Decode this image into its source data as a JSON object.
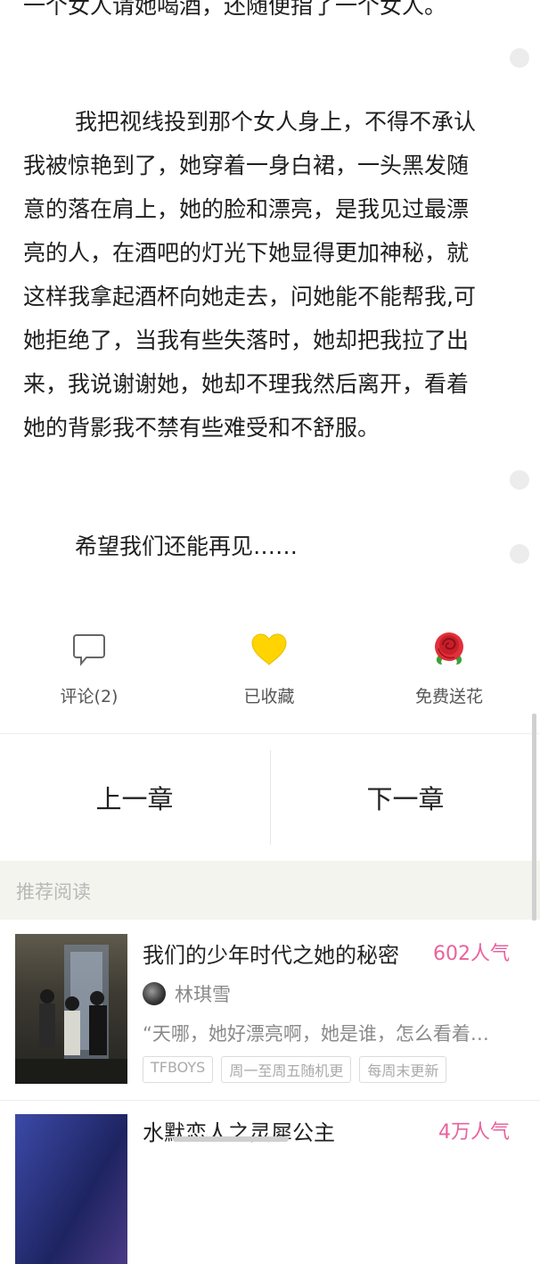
{
  "content": {
    "paragraphs": [
      "一个女人请她喝酒，还随便指了一个女人。",
      "我把视线投到那个女人身上，不得不承认我被惊艳到了，她穿着一身白裙，一头黑发随意的落在肩上，她的脸和漂亮，是我见过最漂亮的人，在酒吧的灯光下她显得更加神秘，就这样我拿起酒杯向她走去，问她能不能帮我,可她拒绝了，当我有些失落时，她却把我拉了出来，我说谢谢她，她却不理我然后离开，看着她的背影我不禁有些难受和不舒服。",
      "希望我们还能再见……"
    ]
  },
  "actions": {
    "comment": {
      "label": "评论(2)",
      "icon": "comment-icon"
    },
    "favorite": {
      "label": "已收藏",
      "icon": "heart-icon",
      "color": "#ffd400"
    },
    "flower": {
      "label": "免费送花",
      "icon": "rose-icon",
      "color": "#e0303a"
    }
  },
  "chapter_nav": {
    "prev": "上一章",
    "next": "下一章"
  },
  "recommend": {
    "header": "推荐阅读",
    "books": [
      {
        "title": "我们的少年时代之她的秘密",
        "popularity": "602人气",
        "author": "林琪雪",
        "excerpt": "“天哪，她好漂亮啊，她是谁，怎么看着…",
        "tags": [
          "TFBOYS",
          "周一至周五随机更",
          "每周末更新"
        ]
      },
      {
        "title": "水默恋人之灵犀公主",
        "popularity": "4万人气"
      }
    ]
  },
  "colors": {
    "popularity": "#e8639c",
    "section_bg": "#f4f4ee"
  }
}
